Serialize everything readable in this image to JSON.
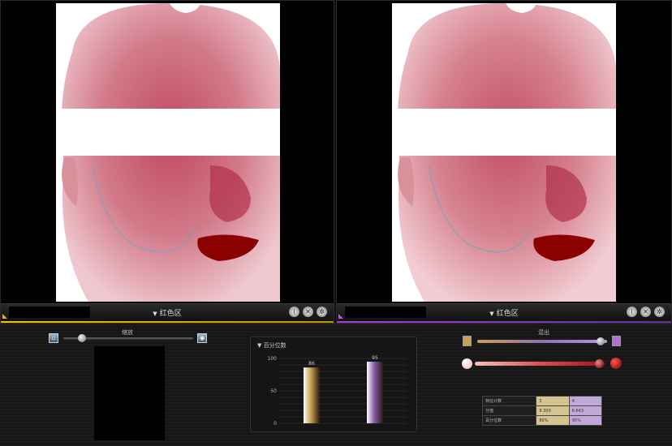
{
  "panels": [
    {
      "title": "红色区",
      "accent": "#f3c000"
    },
    {
      "title": "红色区",
      "accent": "#a040d0"
    }
  ],
  "bottom": {
    "left_section": {
      "label": "缩放",
      "slider_value": 0.1
    },
    "chart_section": {
      "title": "百分位数"
    },
    "right_section": {
      "label": "混出"
    },
    "table": {
      "rows": [
        {
          "label": "特征计数",
          "v1": "5",
          "v2": "4"
        },
        {
          "label": "分值",
          "v1": "8.300",
          "v2": "6.643"
        },
        {
          "label": "百分位数",
          "v1": "86%",
          "v2": "95%"
        }
      ]
    }
  },
  "chart_data": {
    "type": "bar",
    "title": "百分位数",
    "categories": [
      "",
      ""
    ],
    "values": [
      86,
      95
    ],
    "data_labels": [
      "86",
      "95"
    ],
    "ylim": [
      0,
      100
    ],
    "yticks": [
      0,
      50,
      100
    ],
    "colors": [
      "#c8a050",
      "#8a5aa8"
    ],
    "grid": true
  }
}
